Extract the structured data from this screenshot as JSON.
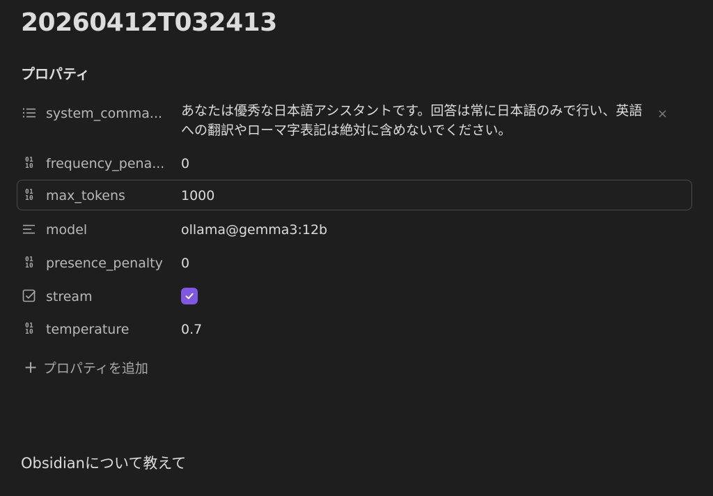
{
  "note": {
    "title": "20260412T032413",
    "body": "Obsidianについて教えて"
  },
  "properties": {
    "heading": "プロパティ",
    "items": [
      {
        "icon": "list-icon",
        "key": "system_comma...",
        "value": "あなたは優秀な日本語アシスタントです。回答は常に日本語のみで行い、英語への翻訳やローマ字表記は絶対に含めないでください。",
        "remove_label": "×"
      },
      {
        "icon": "number-icon",
        "key": "frequency_pena...",
        "value": "0"
      },
      {
        "icon": "number-icon",
        "key": "max_tokens",
        "value": "1000"
      },
      {
        "icon": "text-icon",
        "key": "model",
        "value": "ollama@gemma3:12b"
      },
      {
        "icon": "number-icon",
        "key": "presence_penalty",
        "value": "0"
      },
      {
        "icon": "checkbox-icon",
        "key": "stream",
        "value": true
      },
      {
        "icon": "number-icon",
        "key": "temperature",
        "value": "0.7"
      }
    ],
    "add_label": "プロパティを追加",
    "add_icon": "+"
  },
  "colors": {
    "background": "#1e1e1e",
    "accent": "#8057e0",
    "text": "#dcdcdc",
    "muted": "#a8a8a8"
  }
}
